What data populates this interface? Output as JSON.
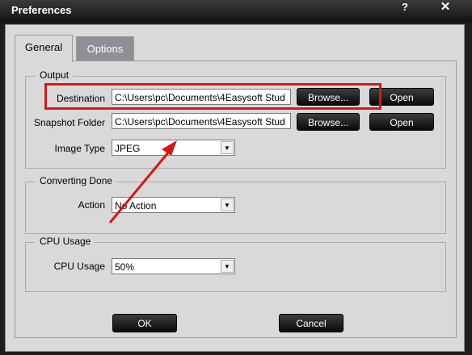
{
  "window": {
    "title": "Preferences",
    "help": "?",
    "close": "✕"
  },
  "tabs": [
    {
      "label": "General"
    },
    {
      "label": "Options"
    }
  ],
  "output": {
    "title": "Output",
    "destination_label": "Destination",
    "destination_value": "C:\\Users\\pc\\Documents\\4Easysoft Stud",
    "snapshot_label": "Snapshot Folder",
    "snapshot_value": "C:\\Users\\pc\\Documents\\4Easysoft Stud",
    "browse": "Browse...",
    "open": "Open",
    "image_type_label": "Image Type",
    "image_type_value": "JPEG"
  },
  "converting": {
    "title": "Converting Done",
    "action_label": "Action",
    "action_value": "No Action"
  },
  "cpu": {
    "title": "CPU Usage",
    "usage_label": "CPU Usage",
    "usage_value": "50%"
  },
  "footer": {
    "ok": "OK",
    "cancel": "Cancel"
  },
  "annotation_color": "#d01a1a"
}
